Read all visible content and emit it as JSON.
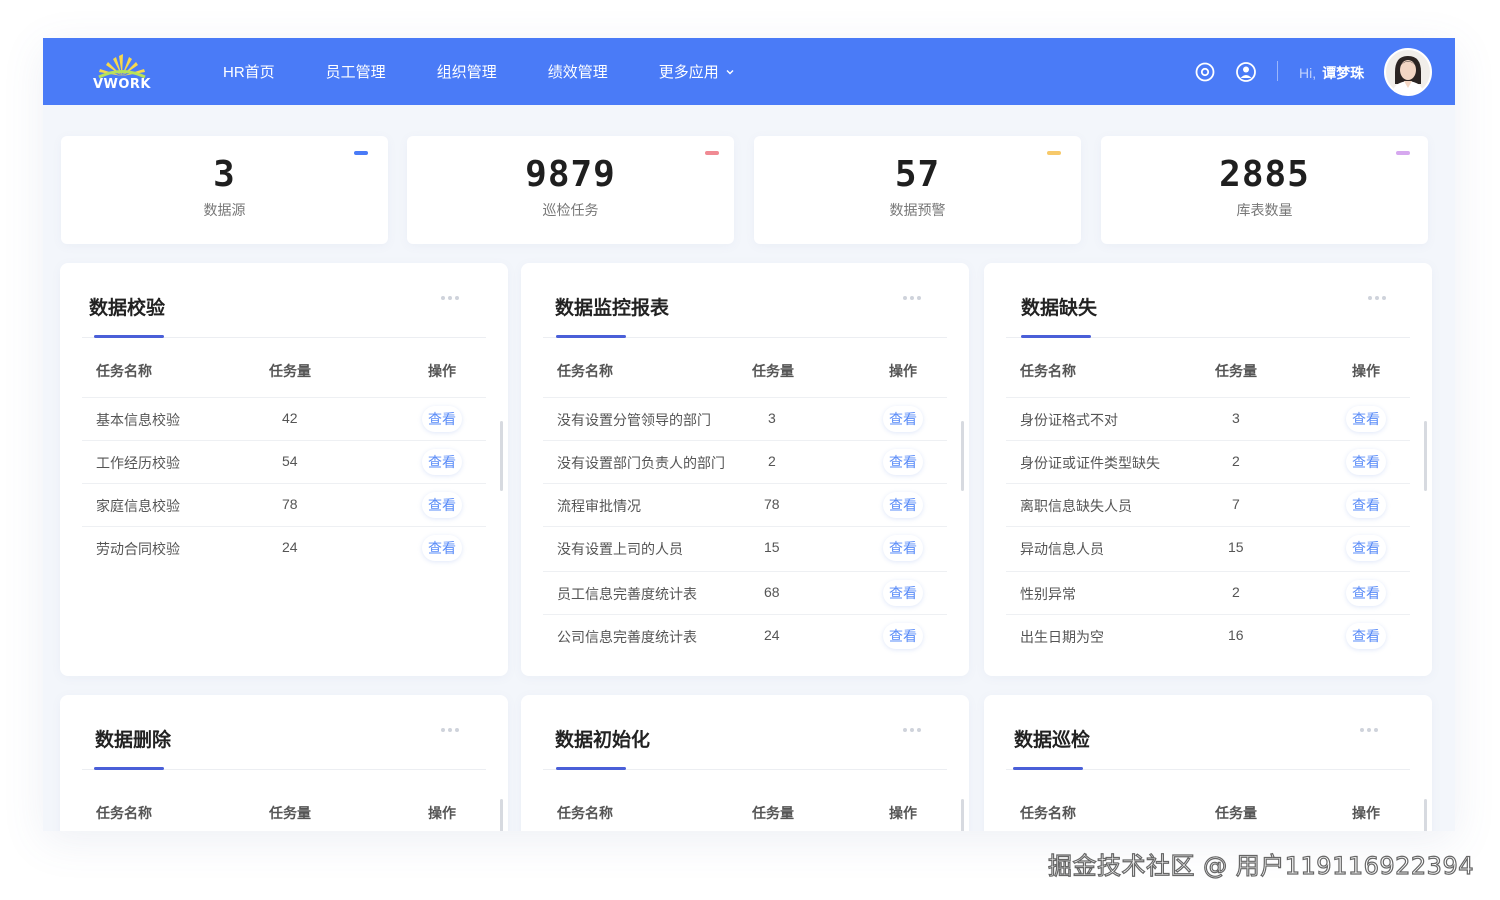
{
  "header": {
    "logo_text": "VWORK",
    "nav": [
      {
        "label": "HR首页"
      },
      {
        "label": "员工管理"
      },
      {
        "label": "组织管理"
      },
      {
        "label": "绩效管理"
      },
      {
        "label": "更多应用"
      }
    ],
    "greeting": "Hi,",
    "user_name": "谭梦珠",
    "icons": [
      "settings-icon",
      "user-icon",
      "chevron-down-icon"
    ]
  },
  "stats": [
    {
      "value": "3",
      "label": "数据源",
      "accent": "#4a7bf7"
    },
    {
      "value": "9879",
      "label": "巡检任务",
      "accent": "#f08a93"
    },
    {
      "value": "57",
      "label": "数据预警",
      "accent": "#f7c96a"
    },
    {
      "value": "2885",
      "label": "库表数量",
      "accent": "#d6a8ef"
    }
  ],
  "panels": [
    {
      "title": "数据校验",
      "columns": [
        "任务名称",
        "任务量",
        "操作"
      ],
      "rows": [
        {
          "name": "基本信息校验",
          "count": "42",
          "action": "查看"
        },
        {
          "name": "工作经历校验",
          "count": "54",
          "action": "查看"
        },
        {
          "name": "家庭信息校验",
          "count": "78",
          "action": "查看"
        },
        {
          "name": "劳动合同校验",
          "count": "24",
          "action": "查看"
        }
      ]
    },
    {
      "title": "数据监控报表",
      "columns": [
        "任务名称",
        "任务量",
        "操作"
      ],
      "rows": [
        {
          "name": "没有设置分管领导的部门",
          "count": "3",
          "action": "查看"
        },
        {
          "name": "没有设置部门负责人的部门",
          "count": "2",
          "action": "查看"
        },
        {
          "name": "流程审批情况",
          "count": "78",
          "action": "查看"
        },
        {
          "name": "没有设置上司的人员",
          "count": "15",
          "action": "查看"
        },
        {
          "name": "员工信息完善度统计表",
          "count": "68",
          "action": "查看"
        },
        {
          "name": "公司信息完善度统计表",
          "count": "24",
          "action": "查看"
        }
      ]
    },
    {
      "title": "数据缺失",
      "columns": [
        "任务名称",
        "任务量",
        "操作"
      ],
      "rows": [
        {
          "name": "身份证格式不对",
          "count": "3",
          "action": "查看"
        },
        {
          "name": "身份证或证件类型缺失",
          "count": "2",
          "action": "查看"
        },
        {
          "name": "离职信息缺失人员",
          "count": "7",
          "action": "查看"
        },
        {
          "name": "异动信息人员",
          "count": "15",
          "action": "查看"
        },
        {
          "name": "性别异常",
          "count": "2",
          "action": "查看"
        },
        {
          "name": "出生日期为空",
          "count": "16",
          "action": "查看"
        }
      ]
    },
    {
      "title": "数据删除",
      "columns": [
        "任务名称",
        "任务量",
        "操作"
      ],
      "rows": []
    },
    {
      "title": "数据初始化",
      "columns": [
        "任务名称",
        "任务量",
        "操作"
      ],
      "rows": []
    },
    {
      "title": "数据巡检",
      "columns": [
        "任务名称",
        "任务量",
        "操作"
      ],
      "rows": []
    }
  ],
  "watermark": "掘金技术社区 @ 用户119116922394"
}
